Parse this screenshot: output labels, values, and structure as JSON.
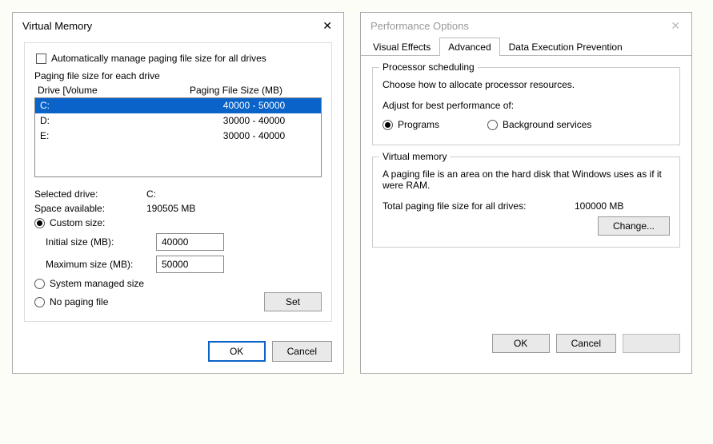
{
  "vm_dialog": {
    "title": "Virtual Memory",
    "auto_manage": "Automatically manage paging file size for all drives",
    "paging_group": "Paging file size for each drive",
    "header_drive": "Drive  [Volume",
    "header_size": "Paging File Size (MB)",
    "drives": [
      {
        "name": "C:",
        "size": "40000 - 50000",
        "selected": true
      },
      {
        "name": "D:",
        "size": "30000 - 40000",
        "selected": false
      },
      {
        "name": "E:",
        "size": "30000 - 40000",
        "selected": false
      }
    ],
    "selected_drive_label": "Selected drive:",
    "selected_drive_value": "C:",
    "space_label": "Space available:",
    "space_value": "190505 MB",
    "custom_size": "Custom size:",
    "initial_label": "Initial size (MB):",
    "initial_value": "40000",
    "max_label": "Maximum size (MB):",
    "max_value": "50000",
    "system_managed": "System managed size",
    "no_paging": "No paging file",
    "set": "Set",
    "ok": "OK",
    "cancel": "Cancel"
  },
  "perf_dialog": {
    "title": "Performance Options",
    "tabs": {
      "visual": "Visual Effects",
      "advanced": "Advanced",
      "dep": "Data Execution Prevention"
    },
    "processor": {
      "legend": "Processor scheduling",
      "desc": "Choose how to allocate processor resources.",
      "adjust": "Adjust for best performance of:",
      "programs": "Programs",
      "background": "Background services"
    },
    "vm": {
      "legend": "Virtual memory",
      "desc": "A paging file is an area on the hard disk that Windows uses as if it were RAM.",
      "total_label": "Total paging file size for all drives:",
      "total_value": "100000 MB",
      "change": "Change..."
    },
    "ok": "OK",
    "cancel": "Cancel"
  }
}
